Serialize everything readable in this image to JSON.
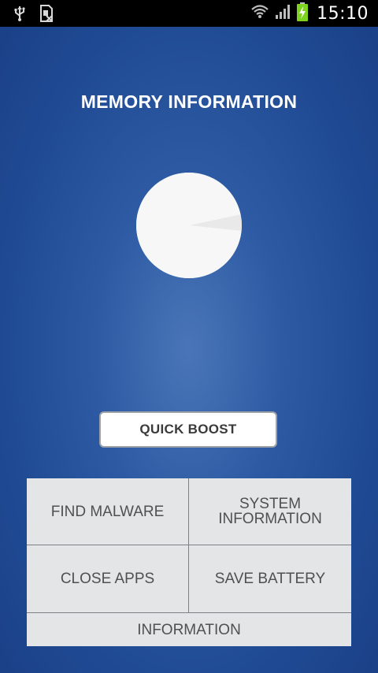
{
  "status_bar": {
    "time": "15:10",
    "icons": [
      "usb-icon",
      "sim-icon",
      "wifi-icon",
      "signal-icon",
      "battery-charging-icon"
    ]
  },
  "title": "MEMORY INFORMATION",
  "memory_chart": {
    "type": "pie",
    "slices": [
      {
        "fraction": 0.05,
        "color": "#e9e9e9"
      },
      {
        "fraction": 0.95,
        "color": "#f7f7f7"
      }
    ]
  },
  "quick_boost_label": "QUICK BOOST",
  "grid": {
    "find_malware": "FIND MALWARE",
    "system_information_line1": "SYSTEM",
    "system_information_line2": "INFORMATION",
    "close_apps": "CLOSE APPS",
    "save_battery": "SAVE BATTERY",
    "information": "INFORMATION"
  },
  "colors": {
    "background": "#2d5aa3",
    "panel": "#e3e5e6",
    "battery": "#7ed321"
  }
}
